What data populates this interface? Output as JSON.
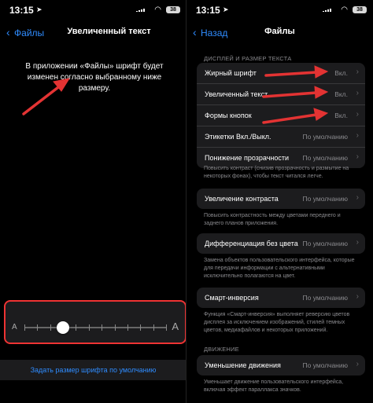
{
  "left": {
    "status": {
      "time": "13:15",
      "battery": "38"
    },
    "nav": {
      "back": "Файлы",
      "title": "Увеличенный текст"
    },
    "info": "В приложении «Файлы» шрифт будет изменен согласно выбранному ниже размеру.",
    "slider": {
      "small_label": "A",
      "large_label": "A",
      "ticks": 12,
      "value_fraction": 0.27
    },
    "reset": "Задать размер шрифта по умолчанию"
  },
  "right": {
    "status": {
      "time": "13:15",
      "battery": "38"
    },
    "nav": {
      "back": "Назад",
      "title": "Файлы"
    },
    "section1_header": "ДИСПЛЕЙ И РАЗМЕР ТЕКСТА",
    "group1": [
      {
        "label": "Жирный шрифт",
        "value": "Вкл."
      },
      {
        "label": "Увеличенный текст",
        "value": "Вкл."
      },
      {
        "label": "Формы кнопок",
        "value": "Вкл."
      },
      {
        "label": "Этикетки Вкл./Выкл.",
        "value": "По умолчанию"
      },
      {
        "label": "Понижение прозрачности",
        "value": "По умолчанию"
      }
    ],
    "note1": "Повысить контраст (снизив прозрачность и размытие на некоторых фонах), чтобы текст читался легче.",
    "contrast": {
      "label": "Увеличение контраста",
      "value": "По умолчанию"
    },
    "note2": "Повысить контрастность между цветами переднего и заднего планов приложения.",
    "diff": {
      "label": "Дифференциация без цвета",
      "value": "По умолчанию"
    },
    "note3": "Замена объектов пользовательского интерфейса, которые для передачи информации с альтернативными исключительно полагаются на цвет.",
    "invert": {
      "label": "Смарт-инверсия",
      "value": "По умолчанию"
    },
    "note4": "Функция «Смарт-инверсия» выполняет реверсию цветов дисплея за исключением изображений, стилей темных цветов, медиафайлов и некоторых приложений.",
    "section2_header": "ДВИЖЕНИЕ",
    "motion": {
      "label": "Уменьшение движения",
      "value": "По умолчанию"
    },
    "note5": "Уменьшает движение пользовательского интерфейса, включая эффект параллакса значков."
  },
  "colors": {
    "accent": "#2f8cff",
    "annotation": "#e33333",
    "cell": "#1c1c1e"
  }
}
